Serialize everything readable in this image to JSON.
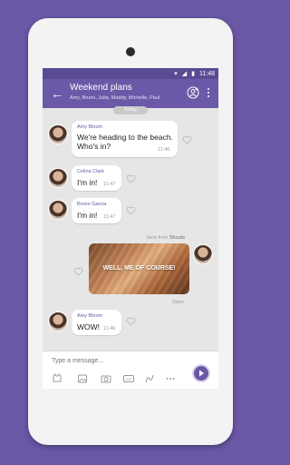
{
  "status_bar": {
    "time": "11:48"
  },
  "header": {
    "title": "Weekend plans",
    "participants": "Amy, Bruno, Julia, Maddy, Michelle, Paul",
    "back_icon": "arrow-back-icon",
    "add_participant_icon": "add-participant-icon",
    "menu_icon": "more-vert-icon"
  },
  "date_divider": "Today",
  "messages": [
    {
      "sender": "Amy Bloom",
      "text_line1": "We're heading to the beach.",
      "text_line2": "Who's in?",
      "time": "11:46"
    },
    {
      "sender": "Celina Clark",
      "text": "I'm in!",
      "time": "11:47"
    },
    {
      "sender": "Bruno Garcia",
      "text": "I'm in!",
      "time": "11:47"
    },
    {
      "sender": "Amy Bloom",
      "text": "WOW!",
      "time": "11:46"
    }
  ],
  "shout": {
    "sent_from_prefix": "Sent from",
    "sent_from_source": "Shouts",
    "text": "WELL, ME OF COURSE!",
    "seen": "Seen"
  },
  "composer": {
    "placeholder": "Type a message...",
    "toolbar": [
      "sticker-icon",
      "gallery-icon",
      "camera-icon",
      "gif-icon",
      "doodle-icon",
      "more-options-icon"
    ]
  },
  "colors": {
    "brand": "#6b59a8",
    "background": "#6a57a6",
    "chat_bg": "#e6e6e6"
  }
}
